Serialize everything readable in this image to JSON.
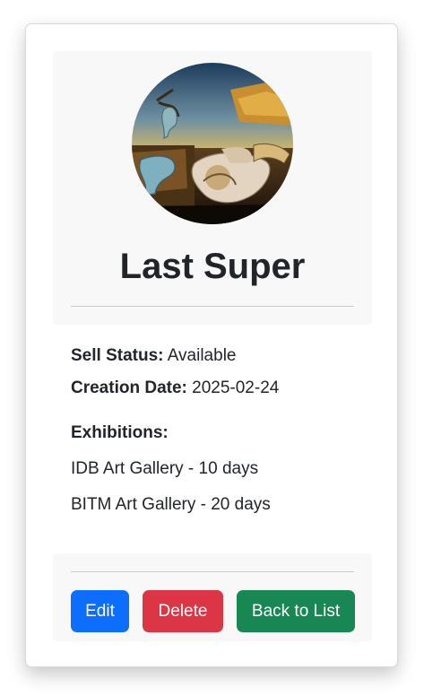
{
  "artwork": {
    "title": "Last Super",
    "image_alt": "artwork-image"
  },
  "details": {
    "sell_status_label": "Sell Status:",
    "sell_status_value": "Available",
    "creation_date_label": "Creation Date:",
    "creation_date_value": "2025-02-24"
  },
  "exhibitions": {
    "heading": "Exhibitions:",
    "items": [
      "IDB Art Gallery - 10 days",
      "BITM Art Gallery - 20 days"
    ]
  },
  "actions": {
    "edit_label": "Edit",
    "delete_label": "Delete",
    "back_label": "Back to List"
  },
  "colors": {
    "primary": "#0d6efd",
    "danger": "#dc3545",
    "success": "#198754"
  }
}
